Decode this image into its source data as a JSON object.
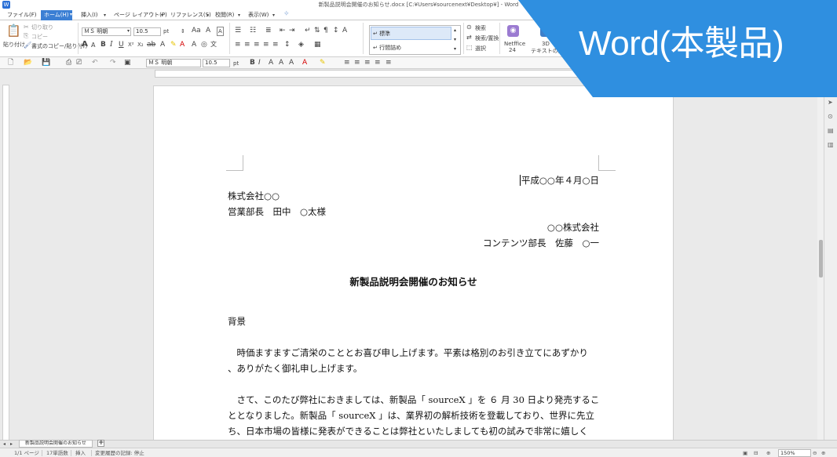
{
  "window": {
    "title": "新製品説明会開催のお知らせ.docx [C:¥Users¥sourcenext¥Desktop¥] - Word"
  },
  "menu": {
    "items": [
      "ファイル(F)",
      "ホーム(H)",
      "挿入(I)",
      "ページ レイアウト(P)",
      "リファレンス(S)",
      "校閲(R)",
      "表示(W)"
    ],
    "active": 1
  },
  "ribbon": {
    "paste_label": "貼り付け",
    "cut_label": "切り取り",
    "copy_label": "コピー",
    "format_painter_label": "書式のコピー/貼り付け",
    "font_name": "ＭＳ 明朝",
    "font_size": "10.5",
    "font_unit": "pt",
    "styles": [
      "標準",
      "行間詰め"
    ],
    "find_label": "検索",
    "replace_label": "検索/置換",
    "select_label": "選択",
    "netffice_label": "Netffice",
    "netffice_sub": "24",
    "threed_label": "3D",
    "threed_sub": "テキストの形"
  },
  "toolbar2": {
    "font_name": "ＭＳ 明朝",
    "font_size": "10.5",
    "font_unit": "pt"
  },
  "banner": {
    "text": "Word(本製品)",
    "color": "#2f8fe0"
  },
  "document": {
    "date": "平成○○年４月○日",
    "to_company": "株式会社○○",
    "to_person": "営業部長　田中　○太様",
    "from_company": "○○株式会社",
    "from_person": "コンテンツ部長　佐藤　○一",
    "heading": "新製品説明会開催のお知らせ",
    "salutation": "背景",
    "para1_l1": "　時価ますますご清栄のこととお喜び申し上げます。平素は格別のお引き立てにあずかり",
    "para1_l2": "、ありがたく御礼申し上げます。",
    "para2_l1": "　さて、このたび弊社におきましては、新製品「 sourceX 」を ６ 月 30 日より発売するこ",
    "para2_l2": "ととなりました。新製品「 sourceX 」は、業界初の解析技術を登載しており、世界に先立",
    "para2_l3": "ち、日本市場の皆様に発表ができることは弊社といたしましても初の試みで非常に嬉しく"
  },
  "tabs": {
    "doc_tab": "新製品説明会開催のお知らせ",
    "add": "+"
  },
  "status": {
    "page": "1/1 ページ",
    "words": "17単語数",
    "mode": "挿入",
    "track": "変更履歴の記録: 停止",
    "zoom": "150%"
  }
}
